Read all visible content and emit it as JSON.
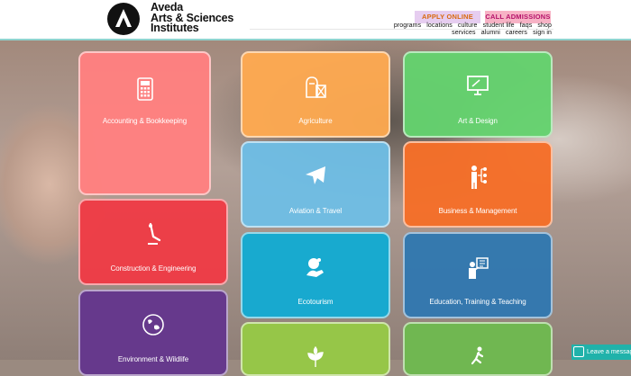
{
  "header": {
    "brand_line1": "Aveda",
    "brand_line2": "Arts & Sciences",
    "brand_line3": "Institutes",
    "apply_label": "APPLY ONLINE",
    "call_label": "CALL ADMISSIONS",
    "nav_row1": [
      "programs",
      "locations",
      "culture",
      "student life",
      "faqs",
      "shop"
    ],
    "nav_row2": [
      "services",
      "alumni",
      "careers",
      "sign in"
    ]
  },
  "tiles": [
    {
      "label": "Accounting & Bookkeeping",
      "icon": "calculator-icon",
      "color": "#ff8080"
    },
    {
      "label": "Agriculture",
      "icon": "farm-icon",
      "color": "#ffaa50"
    },
    {
      "label": "Art & Design",
      "icon": "monitor-icon",
      "color": "#64d26e"
    },
    {
      "label": "Construction & Engineering",
      "icon": "crane-icon",
      "color": "#ee3c46"
    },
    {
      "label": "Aviation & Travel",
      "icon": "airplane-icon",
      "color": "#6ebee6"
    },
    {
      "label": "Business & Management",
      "icon": "org-chart-icon",
      "color": "#f56e28"
    },
    {
      "label": "Ecotourism",
      "icon": "eco-hand-icon",
      "color": "#14aad2"
    },
    {
      "label": "Education, Training & Teaching",
      "icon": "teacher-icon",
      "color": "#3278af"
    },
    {
      "label": "Environment & Wildlife",
      "icon": "globe-icon",
      "color": "#64378c"
    },
    {
      "label": "",
      "icon": "plant-icon",
      "color": "#96c846"
    },
    {
      "label": "",
      "icon": "runner-icon",
      "color": "#6eb950"
    }
  ],
  "chat": {
    "label": "Leave a message"
  }
}
